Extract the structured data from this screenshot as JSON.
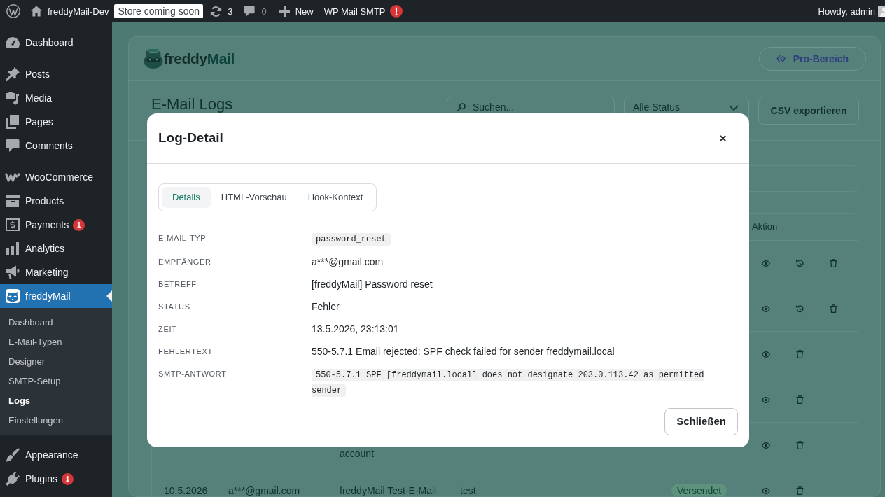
{
  "admin_bar": {
    "site_name": "freddyMail-Dev",
    "store_badge": "Store coming soon",
    "updates_count": "3",
    "comments_count": "0",
    "new_label": "New",
    "plugin_label": "WP Mail SMTP",
    "greeting": "Howdy, admin"
  },
  "sidebar": {
    "groups": [
      {
        "items": [
          {
            "label": "Dashboard",
            "selected": false
          }
        ]
      },
      {
        "items": [
          {
            "label": "Posts",
            "selected": false
          },
          {
            "label": "Media",
            "selected": false
          },
          {
            "label": "Pages",
            "selected": false
          },
          {
            "label": "Comments",
            "selected": false
          }
        ]
      },
      {
        "items": [
          {
            "label": "WooCommerce",
            "selected": false
          },
          {
            "label": "Products",
            "selected": false
          },
          {
            "label": "Payments",
            "selected": false,
            "badge": "1"
          },
          {
            "label": "Analytics",
            "selected": false
          },
          {
            "label": "Marketing",
            "selected": false
          },
          {
            "label": "freddyMail",
            "selected": true,
            "submenu": [
              {
                "label": "Dashboard",
                "selected": false
              },
              {
                "label": "E-Mail-Typen",
                "selected": false
              },
              {
                "label": "Designer",
                "selected": false
              },
              {
                "label": "SMTP-Setup",
                "selected": false
              },
              {
                "label": "Logs",
                "selected": true
              },
              {
                "label": "Einstellungen",
                "selected": false
              }
            ]
          }
        ]
      },
      {
        "items": [
          {
            "label": "Appearance",
            "selected": false
          },
          {
            "label": "Plugins",
            "selected": false,
            "badge": "1"
          }
        ]
      }
    ]
  },
  "page": {
    "logo": {
      "name": "freddy",
      "accent": "Mail"
    },
    "pro_button": "Pro-Bereich",
    "heading": "E-Mail Logs",
    "search": {
      "placeholder": "Suchen..."
    },
    "status_filter": {
      "value": "Alle Status"
    },
    "export_button": "CSV exportieren",
    "table": {
      "action_header": "Aktion",
      "rows": [
        {
          "resend_available": true
        },
        {
          "resend_available": true
        },
        {
          "resend_available": false
        },
        {
          "resend_available": false
        },
        {
          "subject": "account",
          "resend_available": false
        },
        {
          "date": "10.5.2026",
          "recipient": "a***@gmail.com",
          "subject": "freddyMail Test-E-Mail",
          "hook": "test",
          "status": "Versendet",
          "resend_available": false
        }
      ]
    }
  },
  "modal": {
    "title": "Log-Detail",
    "tabs": [
      {
        "label": "Details",
        "selected": true
      },
      {
        "label": "HTML-Vorschau",
        "selected": false
      },
      {
        "label": "Hook-Kontext",
        "selected": false
      }
    ],
    "fields": [
      {
        "label": "E-MAIL-TYP",
        "value": "password_reset",
        "kind": "code"
      },
      {
        "label": "EMPFÄNGER",
        "value": "a***@gmail.com",
        "kind": "text"
      },
      {
        "label": "BETREFF",
        "value": "[freddyMail] Password reset",
        "kind": "text"
      },
      {
        "label": "STATUS",
        "value": "Fehler",
        "kind": "text"
      },
      {
        "label": "ZEIT",
        "value": "13.5.2026, 23:13:01",
        "kind": "text"
      },
      {
        "label": "FEHLERTEXT",
        "value": "550-5.7.1 Email rejected: SPF check failed for sender freddymail.local",
        "kind": "text"
      },
      {
        "label": "SMTP-ANTWORT",
        "value": "550-5.7.1 SPF [freddymail.local] does not designate 203.0.113.42 as permitted sender",
        "kind": "code"
      }
    ],
    "close_button": "Schließen"
  }
}
